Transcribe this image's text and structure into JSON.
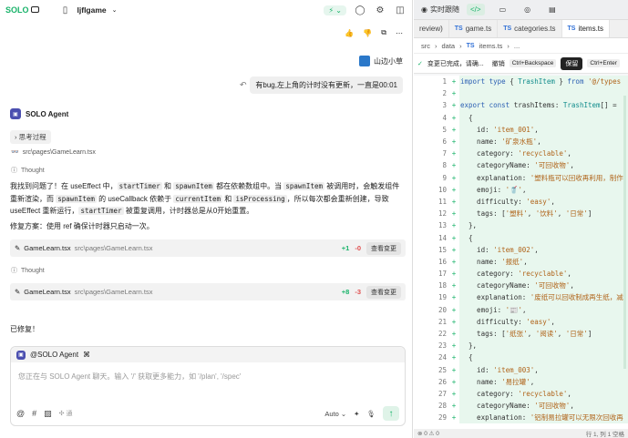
{
  "topbar": {
    "brand": "SOLO",
    "project": "ljflgame"
  },
  "user": {
    "name": "山边小草",
    "message": "有bug,左上角的计时没有更新，一直是00:01"
  },
  "agent": {
    "name": "SOLO Agent",
    "thinking_chip": "思考过程",
    "file_path": "src\\pages\\GameLearn.tsx",
    "thought_label": "Thought",
    "para1_a": "我找到问题了！在 useEffect 中，",
    "c1": "startTimer",
    "para1_b": " 和 ",
    "c2": "spawnItem",
    "para1_c": " 都在依赖数组中。当 ",
    "c3": "spawnItem",
    "para1_d": " 被调用时，会触发组件重新渲染，而 ",
    "c4": "spawnItem",
    "para1_e": " 的 useCallback 依赖于 ",
    "c5": "currentItem",
    "para1_f": " 和 ",
    "c6": "isProcessing",
    "para1_g": "，所以每次都会重新创建，导致 useEffect 重新运行，",
    "c7": "startTimer",
    "para1_h": " 被重复调用，计时器总是从0开始重置。",
    "para2": "修复方案：使用 ref 确保计时器只启动一次。",
    "done": "已修复！"
  },
  "files": [
    {
      "name": "GameLearn.tsx",
      "path": "src\\pages\\GameLearn.tsx",
      "add": "+1",
      "del": "-0",
      "btn": "查看变更"
    },
    {
      "name": "GameLearn.tsx",
      "path": "src\\pages\\GameLearn.tsx",
      "add": "+8",
      "del": "-3",
      "btn": "查看变更"
    }
  ],
  "composer": {
    "mention": "@SOLO Agent",
    "placeholder": "您正在与 SOLO Agent 聊天。输入 '/' 获取更多能力，如 '/plan', '/spec'",
    "opt": "通",
    "mode": "Auto"
  },
  "right": {
    "tab1": "实时跟随",
    "tabs": [
      "review)",
      "game.ts",
      "categories.ts",
      "items.ts"
    ],
    "crumb": [
      "src",
      "data",
      "items.ts",
      "..."
    ],
    "change_msg": "变更已完成，请确...",
    "undo": "撤销",
    "kbd1": "Ctrl+Backspace",
    "save": "保留",
    "kbd2": "Ctrl+Enter",
    "status_left": "⊗ 0 ⚠ 0",
    "status_right": "行 1, 列 1   空格"
  },
  "code_lines": [
    {
      "n": "1",
      "t": [
        [
          "k",
          "import type "
        ],
        [
          "p",
          "{ "
        ],
        [
          "ty",
          "TrashItem"
        ],
        [
          "p",
          " } "
        ],
        [
          "k",
          "from "
        ],
        [
          "s",
          "'@/types"
        ]
      ]
    },
    {
      "n": "2",
      "t": []
    },
    {
      "n": "3",
      "t": [
        [
          "k",
          "export const "
        ],
        [
          "p",
          "trashItems: "
        ],
        [
          "ty",
          "TrashItem"
        ],
        [
          "p",
          "[] ="
        ]
      ]
    },
    {
      "n": "4",
      "t": [
        [
          "p",
          "  {"
        ]
      ]
    },
    {
      "n": "5",
      "t": [
        [
          "p",
          "    id: "
        ],
        [
          "s",
          "'item_001'"
        ],
        [
          "p",
          ","
        ]
      ]
    },
    {
      "n": "6",
      "t": [
        [
          "p",
          "    name: "
        ],
        [
          "s",
          "'矿泉水瓶'"
        ],
        [
          "p",
          ","
        ]
      ]
    },
    {
      "n": "7",
      "t": [
        [
          "p",
          "    category: "
        ],
        [
          "s",
          "'recyclable'"
        ],
        [
          "p",
          ","
        ]
      ]
    },
    {
      "n": "8",
      "t": [
        [
          "p",
          "    categoryName: "
        ],
        [
          "s",
          "'可回收物'"
        ],
        [
          "p",
          ","
        ]
      ]
    },
    {
      "n": "9",
      "t": [
        [
          "p",
          "    explanation: "
        ],
        [
          "s",
          "'塑料瓶可以回收再利用，制作"
        ]
      ]
    },
    {
      "n": "10",
      "t": [
        [
          "p",
          "    emoji: "
        ],
        [
          "s",
          "'🥤'"
        ],
        [
          "p",
          ","
        ]
      ]
    },
    {
      "n": "11",
      "t": [
        [
          "p",
          "    difficulty: "
        ],
        [
          "s",
          "'easy'"
        ],
        [
          "p",
          ","
        ]
      ]
    },
    {
      "n": "12",
      "t": [
        [
          "p",
          "    tags: ["
        ],
        [
          "s",
          "'塑料'"
        ],
        [
          "p",
          ", "
        ],
        [
          "s",
          "'饮料'"
        ],
        [
          "p",
          ", "
        ],
        [
          "s",
          "'日常'"
        ],
        [
          "p",
          "]"
        ]
      ]
    },
    {
      "n": "13",
      "t": [
        [
          "p",
          "  },"
        ]
      ]
    },
    {
      "n": "14",
      "t": [
        [
          "p",
          "  {"
        ]
      ]
    },
    {
      "n": "15",
      "t": [
        [
          "p",
          "    id: "
        ],
        [
          "s",
          "'item_002'"
        ],
        [
          "p",
          ","
        ]
      ]
    },
    {
      "n": "16",
      "t": [
        [
          "p",
          "    name: "
        ],
        [
          "s",
          "'报纸'"
        ],
        [
          "p",
          ","
        ]
      ]
    },
    {
      "n": "17",
      "t": [
        [
          "p",
          "    category: "
        ],
        [
          "s",
          "'recyclable'"
        ],
        [
          "p",
          ","
        ]
      ]
    },
    {
      "n": "18",
      "t": [
        [
          "p",
          "    categoryName: "
        ],
        [
          "s",
          "'可回收物'"
        ],
        [
          "p",
          ","
        ]
      ]
    },
    {
      "n": "19",
      "t": [
        [
          "p",
          "    explanation: "
        ],
        [
          "s",
          "'废纸可以回收制成再生纸，减"
        ]
      ]
    },
    {
      "n": "20",
      "t": [
        [
          "p",
          "    emoji: "
        ],
        [
          "s",
          "'📰'"
        ],
        [
          "p",
          ","
        ]
      ]
    },
    {
      "n": "21",
      "t": [
        [
          "p",
          "    difficulty: "
        ],
        [
          "s",
          "'easy'"
        ],
        [
          "p",
          ","
        ]
      ]
    },
    {
      "n": "22",
      "t": [
        [
          "p",
          "    tags: ["
        ],
        [
          "s",
          "'纸张'"
        ],
        [
          "p",
          ", "
        ],
        [
          "s",
          "'阅读'"
        ],
        [
          "p",
          ", "
        ],
        [
          "s",
          "'日常'"
        ],
        [
          "p",
          "]"
        ]
      ]
    },
    {
      "n": "23",
      "t": [
        [
          "p",
          "  },"
        ]
      ]
    },
    {
      "n": "24",
      "t": [
        [
          "p",
          "  {"
        ]
      ]
    },
    {
      "n": "25",
      "t": [
        [
          "p",
          "    id: "
        ],
        [
          "s",
          "'item_003'"
        ],
        [
          "p",
          ","
        ]
      ]
    },
    {
      "n": "26",
      "t": [
        [
          "p",
          "    name: "
        ],
        [
          "s",
          "'易拉罐'"
        ],
        [
          "p",
          ","
        ]
      ]
    },
    {
      "n": "27",
      "t": [
        [
          "p",
          "    category: "
        ],
        [
          "s",
          "'recyclable'"
        ],
        [
          "p",
          ","
        ]
      ]
    },
    {
      "n": "28",
      "t": [
        [
          "p",
          "    categoryName: "
        ],
        [
          "s",
          "'可回收物'"
        ],
        [
          "p",
          ","
        ]
      ]
    },
    {
      "n": "29",
      "t": [
        [
          "p",
          "    explanation: "
        ],
        [
          "s",
          "'铝制易拉罐可以无限次回收再"
        ]
      ]
    }
  ]
}
